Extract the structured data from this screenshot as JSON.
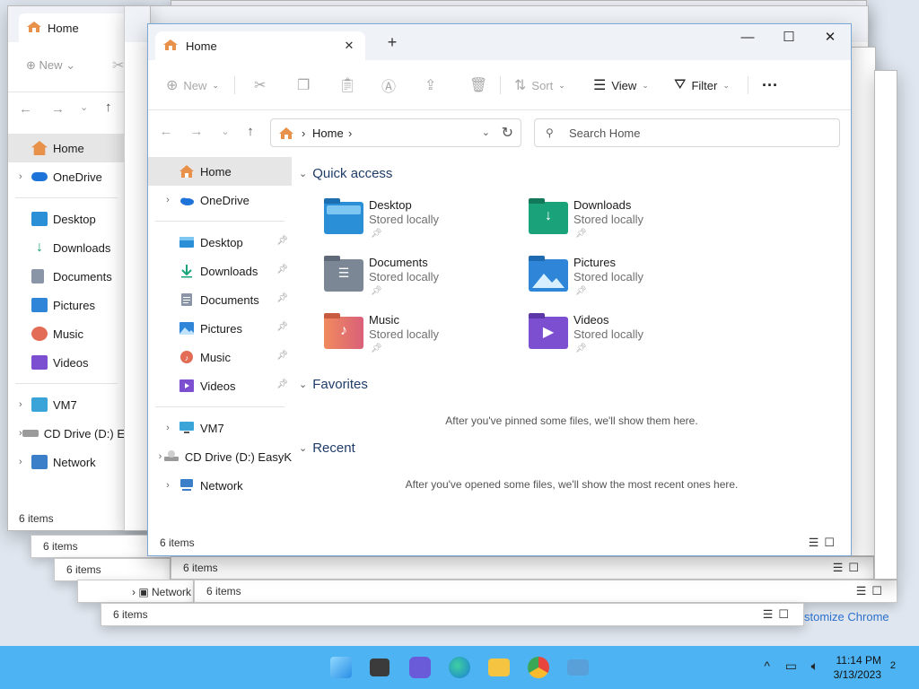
{
  "window": {
    "tab_title": "Home",
    "new_tab_symbol": "+",
    "close_tab_symbol": "✕",
    "minimize_symbol": "—",
    "maximize_symbol": "☐",
    "close_symbol": "✕"
  },
  "toolbar": {
    "new_label": "New",
    "sort_label": "Sort",
    "view_label": "View",
    "filter_label": "Filter",
    "more_label": "···"
  },
  "address": {
    "separator": "›",
    "crumb": "Home",
    "search_placeholder": "Search Home"
  },
  "sidebar": {
    "home": "Home",
    "onedrive": "OneDrive",
    "pinned": [
      {
        "label": "Desktop",
        "icon": "desktop-icon",
        "color": "#2a8fd6"
      },
      {
        "label": "Downloads",
        "icon": "downloads-icon",
        "color": "#1aa37a"
      },
      {
        "label": "Documents",
        "icon": "documents-icon",
        "color": "#8a96a8"
      },
      {
        "label": "Pictures",
        "icon": "pictures-icon",
        "color": "#2f86d8"
      },
      {
        "label": "Music",
        "icon": "music-icon",
        "color": "#e26c55"
      },
      {
        "label": "Videos",
        "icon": "videos-icon",
        "color": "#7b4fd0"
      }
    ],
    "vm": "VM7",
    "cd_drive": "CD Drive (D:) EasyK",
    "cd_drive_back": "CD Drive (D:) E",
    "network": "Network"
  },
  "content": {
    "quick_access_title": "Quick access",
    "quick_access": [
      {
        "name": "Desktop",
        "status": "Stored locally",
        "icon": "desktop-folder-icon",
        "color": "#2a8fd6"
      },
      {
        "name": "Downloads",
        "status": "Stored locally",
        "icon": "downloads-folder-icon",
        "color": "#1aa37a"
      },
      {
        "name": "Documents",
        "status": "Stored locally",
        "icon": "documents-folder-icon",
        "color": "#7c8796"
      },
      {
        "name": "Pictures",
        "status": "Stored locally",
        "icon": "pictures-folder-icon",
        "color": "#2f86d8"
      },
      {
        "name": "Music",
        "status": "Stored locally",
        "icon": "music-folder-icon",
        "color": "#e07a55"
      },
      {
        "name": "Videos",
        "status": "Stored locally",
        "icon": "videos-folder-icon",
        "color": "#7b4fd0"
      }
    ],
    "favorites_title": "Favorites",
    "favorites_empty": "After you've pinned some files, we'll show them here.",
    "recent_title": "Recent",
    "recent_empty": "After you've opened some files, we'll show the most recent ones here."
  },
  "status": {
    "items_count": "6 items"
  },
  "background_text": {
    "network_label": "Network",
    "customize_chrome": "stomize Chrome"
  },
  "taskbar": {
    "time": "11:14 PM",
    "date": "3/13/2023",
    "notification_count": "2"
  }
}
